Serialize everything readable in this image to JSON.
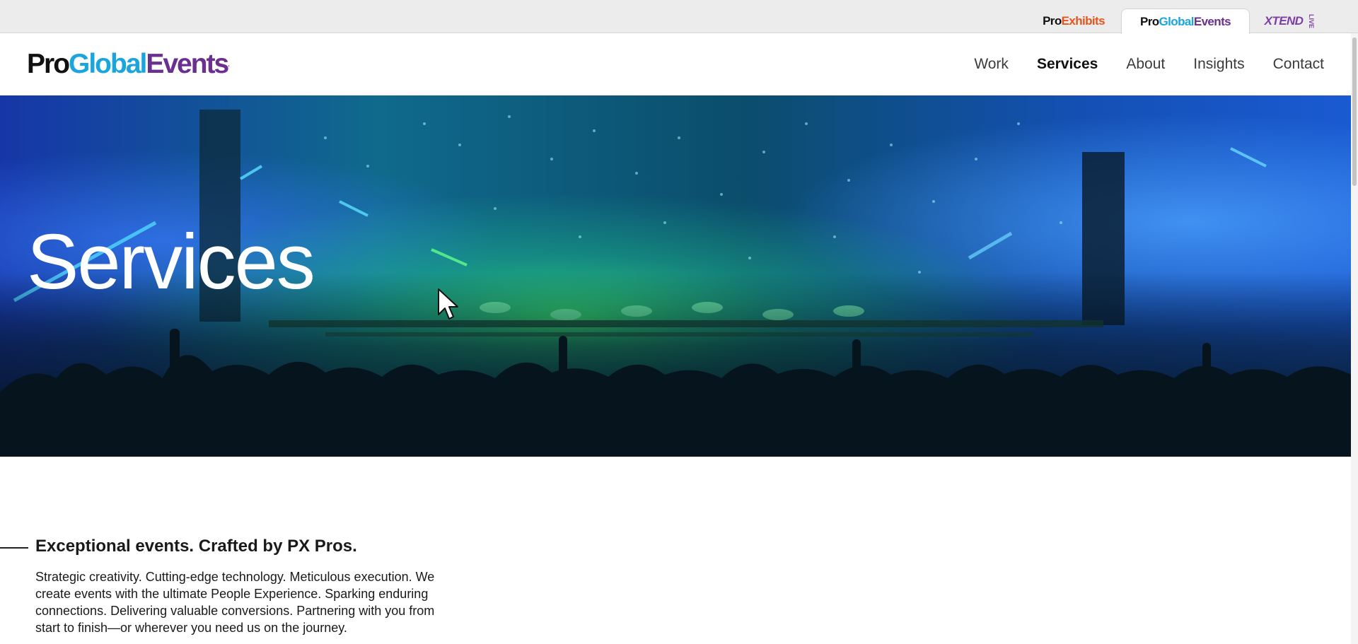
{
  "brand_tabs": [
    {
      "part1": "Pro",
      "part2": "Exhibits",
      "active": false
    },
    {
      "part1": "Pro",
      "part2": "Global",
      "part3": "Events",
      "active": true
    },
    {
      "part1": "X",
      "part2": "TEND",
      "part3": "LIVE",
      "active": false
    }
  ],
  "header": {
    "logo": {
      "part1": "Pro",
      "part2": "Global",
      "part3": "Events",
      "tm": "."
    },
    "nav": [
      {
        "label": "Work",
        "active": false
      },
      {
        "label": "Services",
        "active": true
      },
      {
        "label": "About",
        "active": false
      },
      {
        "label": "Insights",
        "active": false
      },
      {
        "label": "Contact",
        "active": false
      }
    ]
  },
  "hero": {
    "title": "Services",
    "image_icon": "concert-crowd-image"
  },
  "intro": {
    "heading": "Exceptional events. Crafted by PX Pros.",
    "body": "Strategic creativity. Cutting-edge technology. Meticulous execution. We create events with the ultimate People Experience. Sparking enduring connections. Delivering valuable conversions. Partnering with you from start to finish—or wherever you need us on the journey."
  },
  "colors": {
    "brand_dark": "#111111",
    "brand_blue": "#1aa6dc",
    "brand_purple": "#6a2f8f",
    "brand_orange": "#e8541c"
  }
}
